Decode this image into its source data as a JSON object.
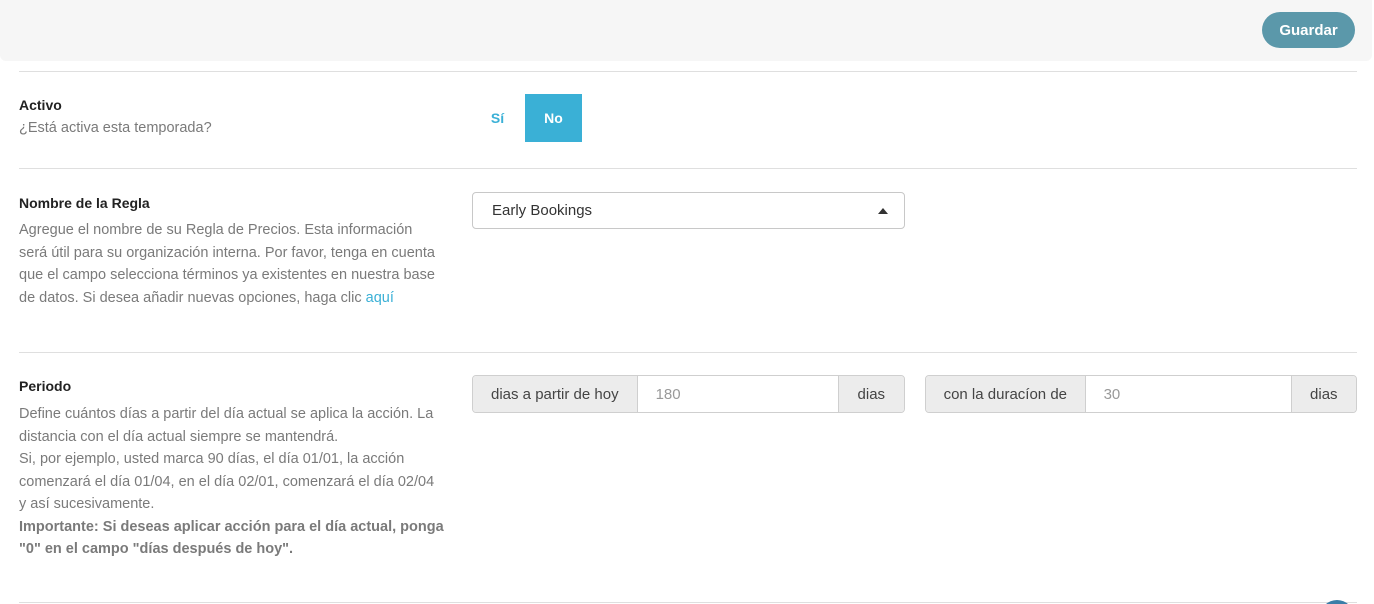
{
  "toolbar": {
    "save_label": "Guardar"
  },
  "colors": {
    "accent": "#3ab0d6",
    "save_button": "#5b98aa"
  },
  "active": {
    "title": "Activo",
    "description": "¿Está activa esta temporada?",
    "options": [
      "Sí",
      "No"
    ],
    "selected": "No"
  },
  "rule_name": {
    "title": "Nombre de la Regla",
    "description_lines": [
      "Agregue el nombre de su Regla de Precios. Esta información",
      "será útil para su organización interna. Por favor, tenga en cuenta",
      "que el campo selecciona términos ya existentes en nuestra base",
      "de datos. Si desea añadir nuevas opciones, haga clic "
    ],
    "link_text": "aquí",
    "selected_value": "Early Bookings",
    "caret_icon": "caret-up-icon"
  },
  "period": {
    "title": "Periodo",
    "description_lines": [
      "Define cuántos días a partir del día actual se aplica la acción. La",
      "distancia con el día actual siempre se mantendrá.",
      "Si, por ejemplo, usted marca 90 días, el día 01/01, la acción",
      "comenzará el día 01/04, en el día 02/01, comenzará el día 02/04",
      "y así sucesivamente."
    ],
    "important_lines": [
      "Importante: Si deseas aplicar acción para el día actual, ponga",
      "\"0\" en el campo \"días después de hoy\"."
    ],
    "offset_prefix": "dias a partir de hoy",
    "offset_value": "180",
    "offset_suffix": "dias",
    "duration_prefix": "con la duracíon de",
    "duration_value": "30",
    "duration_suffix": "dias"
  }
}
